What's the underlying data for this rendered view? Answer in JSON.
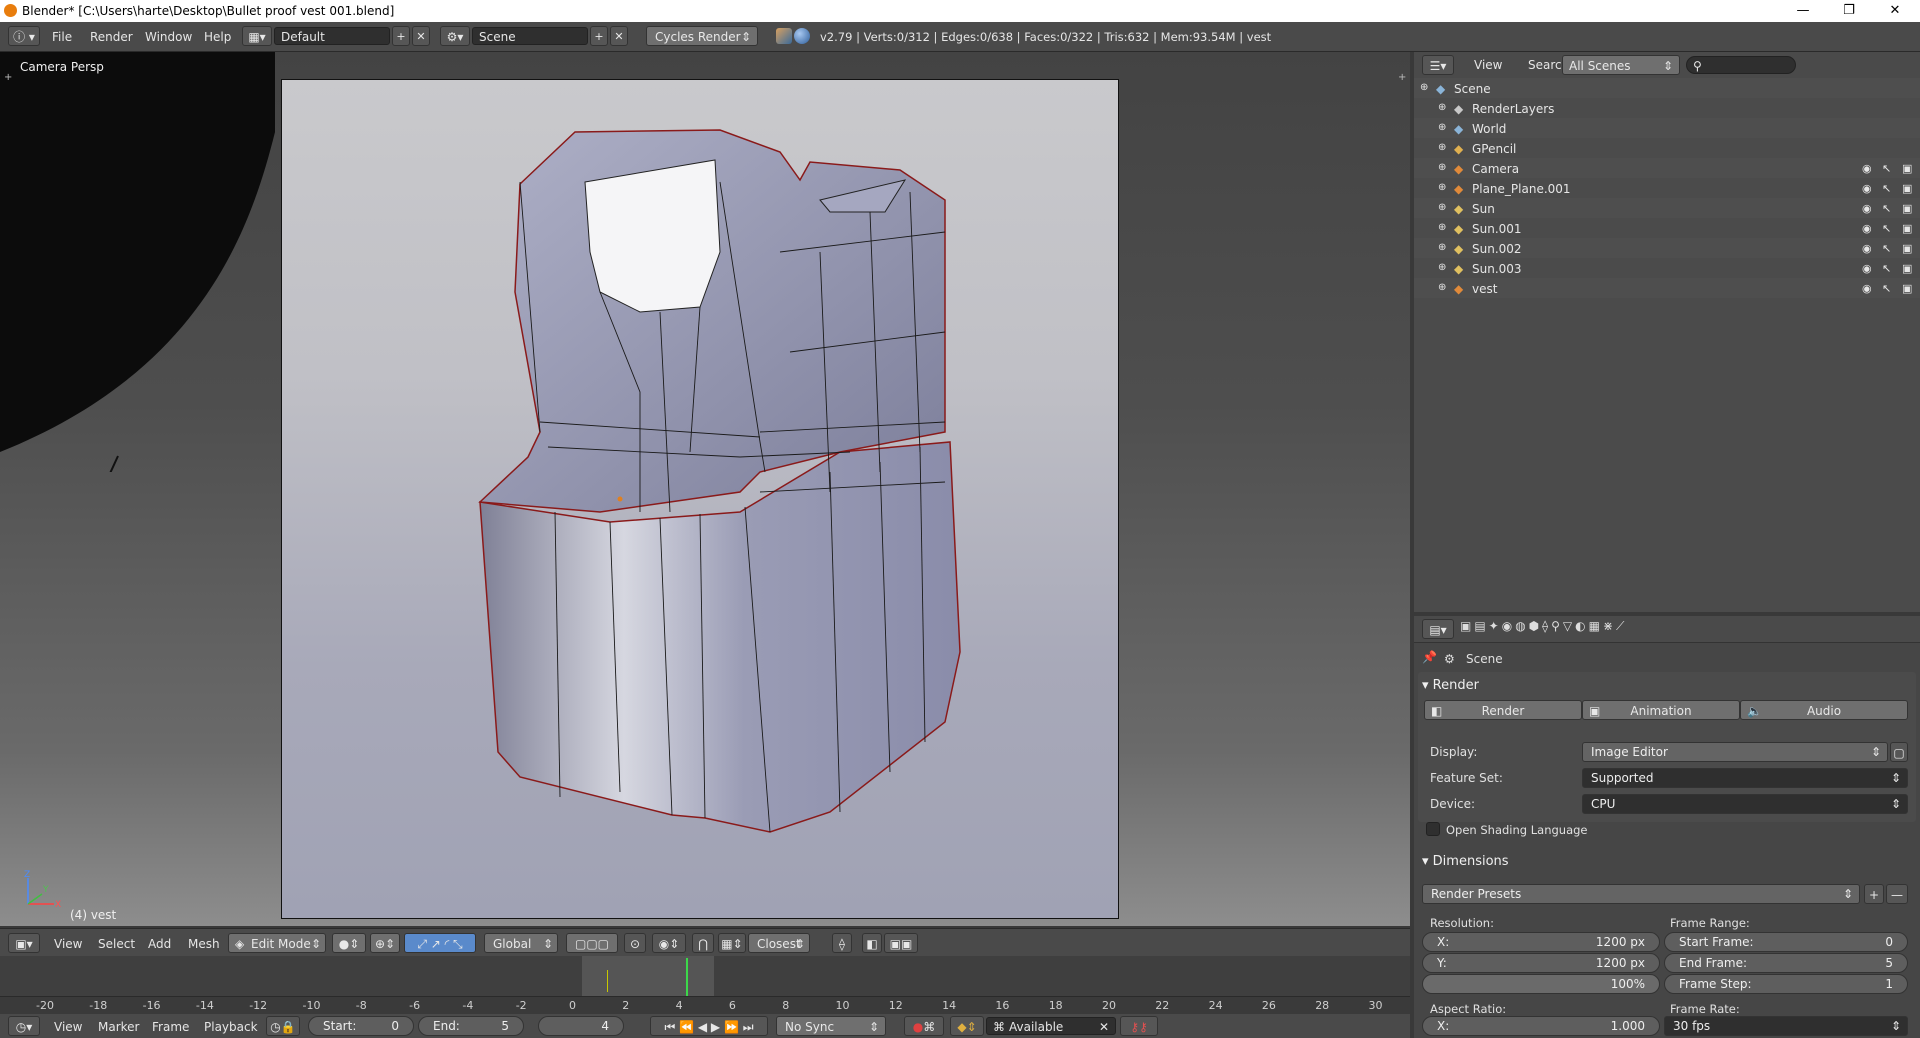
{
  "window": {
    "title": "Blender* [C:\\Users\\harte\\Desktop\\Bullet proof vest 001.blend]",
    "minimize": "—",
    "maximize": "❐",
    "close": "✕"
  },
  "info_header": {
    "menus": [
      "File",
      "Render",
      "Window",
      "Help"
    ],
    "layout": "Default",
    "scene": "Scene",
    "engine": "Cycles Render",
    "stats": "v2.79 | Verts:0/312 | Edges:0/638 | Faces:0/322 | Tris:632 | Mem:93.54M | vest"
  },
  "viewport": {
    "view_name": "Camera Persp",
    "object_label": "(4) vest"
  },
  "viewport_header": {
    "menus": [
      "View",
      "Select",
      "Add",
      "Mesh"
    ],
    "mode": "Edit Mode",
    "orientation": "Global",
    "snap": "Closest"
  },
  "timeline": {
    "ticks": [
      "-20",
      "-18",
      "-16",
      "-14",
      "-12",
      "-10",
      "-8",
      "-6",
      "-4",
      "-2",
      "0",
      "2",
      "4",
      "6",
      "8",
      "10",
      "12",
      "14",
      "16",
      "18",
      "20",
      "22",
      "24",
      "26",
      "28",
      "30"
    ],
    "menus": [
      "View",
      "Marker",
      "Frame",
      "Playback"
    ],
    "start_label": "Start:",
    "start_value": "0",
    "end_label": "End:",
    "end_value": "5",
    "current_frame": "4",
    "sync": "No Sync",
    "keying": "Available"
  },
  "outliner": {
    "menus": [
      "View",
      "Search"
    ],
    "filter": "All Scenes",
    "items": [
      {
        "label": "Scene",
        "icon": "scene-icon",
        "color": "#8ab4d8"
      },
      {
        "label": "RenderLayers",
        "icon": "renderlayers-icon",
        "color": "#c8c8c8"
      },
      {
        "label": "World",
        "icon": "world-icon",
        "color": "#8ab4d8"
      },
      {
        "label": "GPencil",
        "icon": "gpencil-icon",
        "color": "#e0b050"
      },
      {
        "label": "Camera",
        "icon": "camera-icon",
        "color": "#e08a3a"
      },
      {
        "label": "Plane_Plane.001",
        "icon": "mesh-icon",
        "color": "#e08a3a"
      },
      {
        "label": "Sun",
        "icon": "lamp-icon",
        "color": "#e0c060"
      },
      {
        "label": "Sun.001",
        "icon": "lamp-icon",
        "color": "#e0c060"
      },
      {
        "label": "Sun.002",
        "icon": "lamp-icon",
        "color": "#e0c060"
      },
      {
        "label": "Sun.003",
        "icon": "lamp-icon",
        "color": "#e0c060"
      },
      {
        "label": "vest",
        "icon": "mesh-icon",
        "color": "#e08a3a"
      }
    ]
  },
  "properties": {
    "context": "Scene",
    "render_panel": "Render",
    "render_btn": "Render",
    "animation_btn": "Animation",
    "audio_btn": "Audio",
    "display_label": "Display:",
    "display_value": "Image Editor",
    "feature_label": "Feature Set:",
    "feature_value": "Supported",
    "device_label": "Device:",
    "device_value": "CPU",
    "osl_label": "Open Shading Language",
    "dimensions_panel": "Dimensions",
    "presets": "Render Presets",
    "resolution_label": "Resolution:",
    "res_x_label": "X:",
    "res_x": "1200 px",
    "res_y_label": "Y:",
    "res_y": "1200 px",
    "res_pct": "100%",
    "aspect_label": "Aspect Ratio:",
    "aspect_x_label": "X:",
    "aspect_x": "1.000",
    "frame_range_label": "Frame Range:",
    "start_frame_label": "Start Frame:",
    "start_frame": "0",
    "end_frame_label": "End Frame:",
    "end_frame": "5",
    "frame_step_label": "Frame Step:",
    "frame_step": "1",
    "frame_rate_label": "Frame Rate:",
    "frame_rate": "30 fps"
  }
}
